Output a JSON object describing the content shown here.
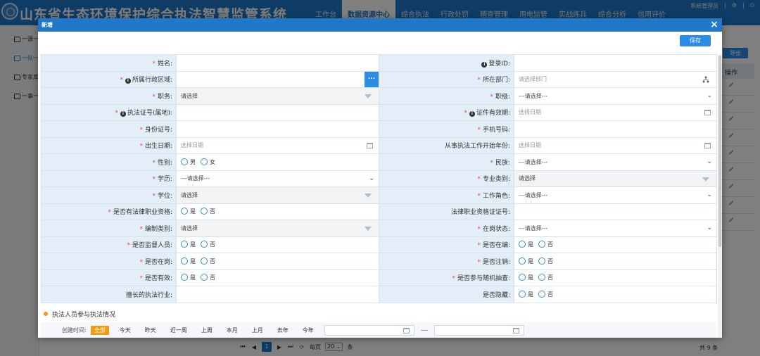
{
  "app": {
    "title": "山东省生态环境保护综合执法智慧监管系统",
    "nav": [
      "工作台",
      "数据资源中心",
      "综合执法",
      "行政处罚",
      "稽查管理",
      "用电监管",
      "实战练兵",
      "综合分析",
      "信用评价"
    ],
    "nav_active": "数据资源中心",
    "user": "系统管理员",
    "user_sep": "|",
    "gear_label": "⚙",
    "power_label": "⏻",
    "sidebar": [
      "一源一",
      "一队一",
      "专家库",
      "一事一"
    ],
    "export_label": "导出",
    "table_header": "操作",
    "pager": {
      "first": "⏮",
      "prev": "◀",
      "current": "1",
      "next": "▶",
      "last": "⏭",
      "refresh": "⟳",
      "per_page_prefix": "每页",
      "per_page": "20",
      "per_page_suffix": "条",
      "total": "共 9 条"
    }
  },
  "modal": {
    "title": "新增",
    "close_icon": "×",
    "save_label": "保存",
    "dots_label": "...",
    "section_title": "执法人员参与执法情况",
    "filter": {
      "label": "创建时间:",
      "options": [
        "全部",
        "今天",
        "昨天",
        "近一周",
        "上周",
        "本月",
        "上月",
        "去年",
        "今年"
      ],
      "active": "全部"
    }
  },
  "form": {
    "rows": [
      [
        {
          "label": "姓名:",
          "required": true,
          "type": "text"
        },
        {
          "label": "登录ID:",
          "info": true,
          "type": "text"
        }
      ],
      [
        {
          "label": "所属行政区域:",
          "required": true,
          "info": true,
          "type": "picker"
        },
        {
          "label": "所在部门:",
          "required": true,
          "type": "tree",
          "placeholder": "请选择部门"
        }
      ],
      [
        {
          "label": "职务:",
          "required": true,
          "type": "grey-select",
          "value": "请选择"
        },
        {
          "label": "职级:",
          "required": true,
          "type": "select",
          "value": "---请选择---"
        }
      ],
      [
        {
          "label": "执法证号(属地):",
          "required": true,
          "info": true,
          "type": "text"
        },
        {
          "label": "证件有效期:",
          "required": true,
          "info": true,
          "type": "date",
          "placeholder": "选择日期"
        }
      ],
      [
        {
          "label": "身份证号:",
          "required": true,
          "type": "text"
        },
        {
          "label": "手机号码:",
          "required": true,
          "type": "text"
        }
      ],
      [
        {
          "label": "出生日期:",
          "required": true,
          "type": "date",
          "placeholder": "选择日期"
        },
        {
          "label": "从事执法工作开始年份:",
          "type": "date",
          "placeholder": "选择日期"
        }
      ],
      [
        {
          "label": "性别:",
          "required": true,
          "type": "radio",
          "options": [
            "男",
            "女"
          ]
        },
        {
          "label": "民族:",
          "required": true,
          "type": "select",
          "value": "---请选择---"
        }
      ],
      [
        {
          "label": "学历:",
          "required": true,
          "type": "select",
          "value": "---请选择---"
        },
        {
          "label": "专业类别:",
          "required": true,
          "type": "grey-select",
          "value": "请选择"
        }
      ],
      [
        {
          "label": "学位:",
          "required": true,
          "type": "grey-select",
          "value": "请选择"
        },
        {
          "label": "工作角色:",
          "required": true,
          "type": "select",
          "value": "---请选择---"
        }
      ],
      [
        {
          "label": "是否有法律职业资格:",
          "required": true,
          "type": "radio",
          "options": [
            "是",
            "否"
          ]
        },
        {
          "label": "法律职业资格证证号:",
          "type": "text"
        }
      ],
      [
        {
          "label": "编制类别:",
          "required": true,
          "type": "grey-select",
          "value": "请选择"
        },
        {
          "label": "在岗状态:",
          "required": true,
          "type": "select",
          "value": "---请选择---"
        }
      ],
      [
        {
          "label": "是否监督人员:",
          "required": true,
          "type": "radio",
          "options": [
            "是",
            "否"
          ]
        },
        {
          "label": "是否在编:",
          "required": true,
          "type": "radio",
          "options": [
            "是",
            "否"
          ]
        }
      ],
      [
        {
          "label": "是否在岗:",
          "required": true,
          "type": "radio",
          "options": [
            "是",
            "否"
          ]
        },
        {
          "label": "是否注销:",
          "required": true,
          "type": "radio",
          "options": [
            "是",
            "否"
          ]
        }
      ],
      [
        {
          "label": "是否有效:",
          "required": true,
          "type": "radio",
          "options": [
            "是",
            "否"
          ]
        },
        {
          "label": "是否参与随机抽查:",
          "required": true,
          "type": "radio",
          "options": [
            "是",
            "否"
          ]
        }
      ],
      [
        {
          "label": "擅长的执法行业:",
          "type": "text"
        },
        {
          "label": "是否隐藏:",
          "type": "radio",
          "options": [
            "是",
            "否"
          ]
        }
      ]
    ]
  }
}
